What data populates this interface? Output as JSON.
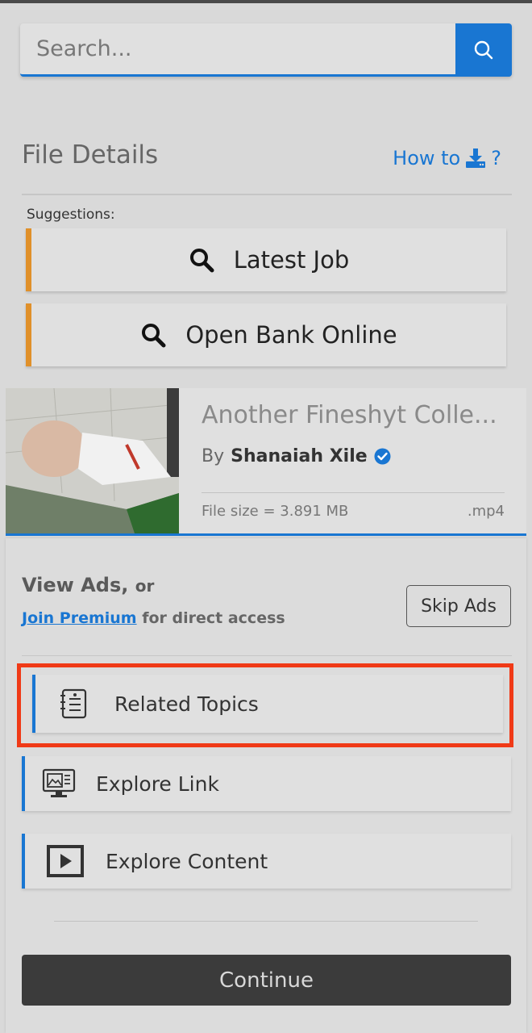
{
  "search": {
    "placeholder": "Search..."
  },
  "header": {
    "title": "File Details",
    "howto_label": "How to",
    "howto_suffix": "?"
  },
  "suggestions": {
    "label": "Suggestions:",
    "items": [
      {
        "label": "Latest Job"
      },
      {
        "label": "Open Bank Online"
      }
    ]
  },
  "file": {
    "title": "Another Fineshyt Colle...",
    "by_prefix": "By",
    "author": "Shanaiah Xile",
    "size": "File size = 3.891 MB",
    "ext": ".mp4"
  },
  "ads": {
    "view_ads": "View Ads,",
    "or": "or",
    "join_premium": "Join Premium",
    "direct_access": "for direct access",
    "skip_label": "Skip Ads"
  },
  "options": [
    {
      "label": "Related Topics",
      "icon": "list-document-icon"
    },
    {
      "label": "Explore Link",
      "icon": "monitor-icon"
    },
    {
      "label": "Explore Content",
      "icon": "play-icon"
    }
  ],
  "continue_label": "Continue",
  "colors": {
    "accent": "#1976d2",
    "suggestion_border": "#e0902a",
    "highlight": "#f03a17",
    "button_dark": "#3b3b3b"
  }
}
